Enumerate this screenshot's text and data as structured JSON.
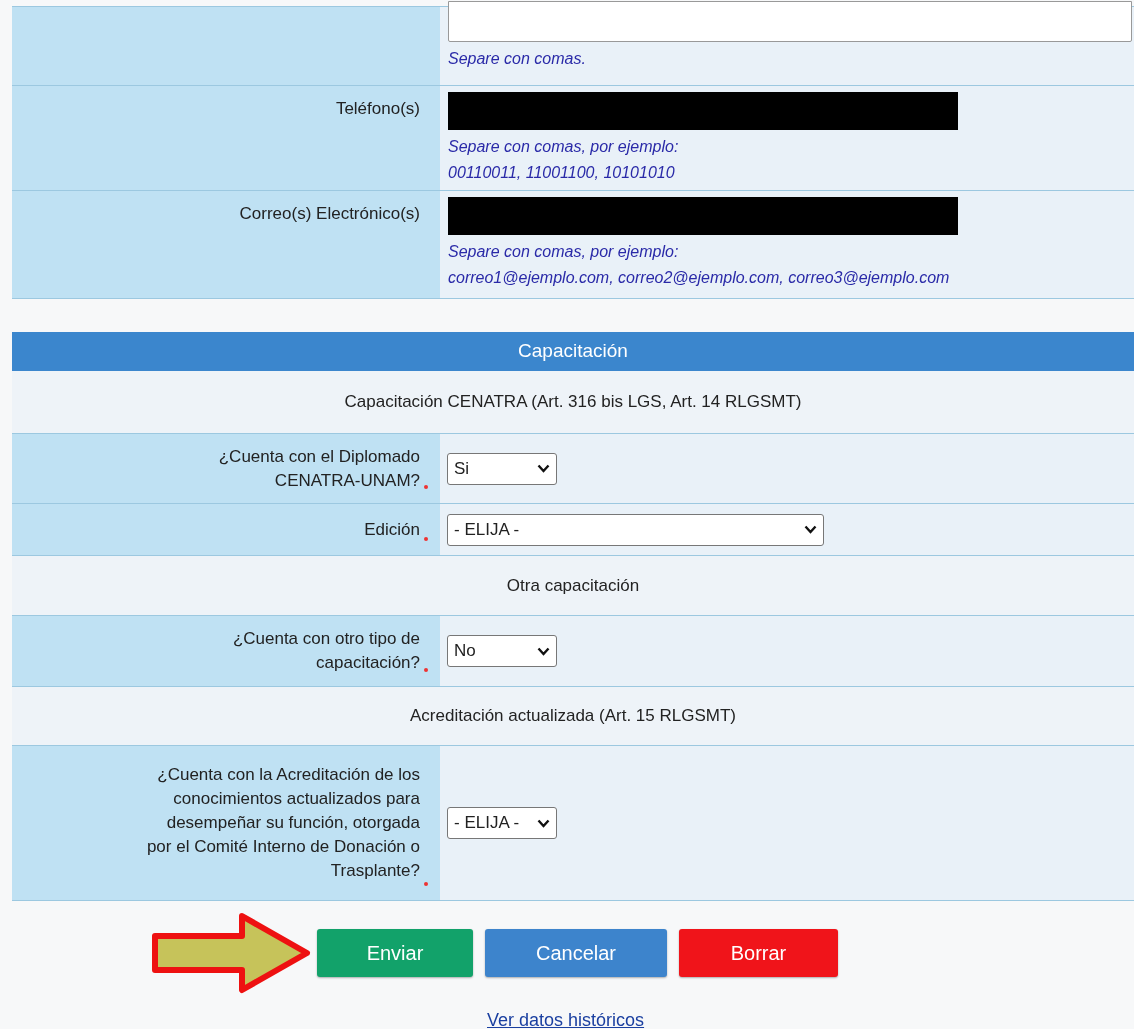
{
  "contact_rows": [
    {
      "label": "",
      "kind": "textarea",
      "hints": [
        "Separe con comas."
      ]
    },
    {
      "label": "Teléfono(s)",
      "kind": "redacted",
      "hints": [
        "Separe con comas, por ejemplo:",
        "00110011, 11001100, 10101010"
      ]
    },
    {
      "label": "Correo(s) Electrónico(s)",
      "kind": "redacted",
      "hints": [
        "Separe con comas, por ejemplo:",
        "correo1@ejemplo.com, correo2@ejemplo.com, correo3@ejemplo.com"
      ]
    }
  ],
  "section": {
    "title": "Capacitación",
    "rows": [
      {
        "kind": "subheading",
        "text": "Capacitación CENATRA (Art. 316 bis LGS, Art. 14 RLGSMT)"
      },
      {
        "kind": "select",
        "label": "¿Cuenta con el Diplomado CENATRA-UNAM?",
        "required": true,
        "value": "Si"
      },
      {
        "kind": "longselect",
        "label": "Edición",
        "required": true,
        "value": "- ELIJA -"
      },
      {
        "kind": "subheading",
        "text": "Otra capacitación"
      },
      {
        "kind": "select",
        "label": "¿Cuenta con otro tipo de capacitación?",
        "required": true,
        "value": "No"
      },
      {
        "kind": "subheading",
        "text": "Acreditación actualizada (Art. 15 RLGSMT)"
      },
      {
        "kind": "select",
        "label": "¿Cuenta con la Acreditación de los conocimientos actualizados para desempeñar su función, otorgada por el Comité Interno de Donación o Trasplante?",
        "required": true,
        "value": "- ELIJA -"
      }
    ]
  },
  "buttons": [
    {
      "label": "Enviar",
      "kind": "submit"
    },
    {
      "label": "Cancelar",
      "kind": "cancel"
    },
    {
      "label": "Borrar",
      "kind": "delete"
    }
  ],
  "pointer_arrow": true,
  "link": "Ver datos históricos"
}
